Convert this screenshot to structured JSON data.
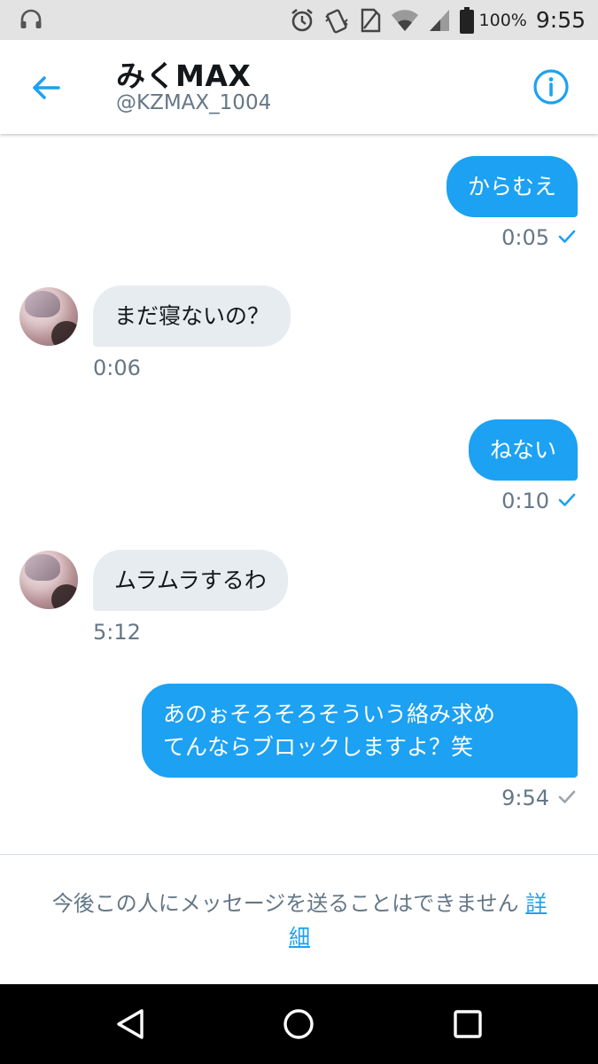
{
  "status_bar": {
    "battery": "100%",
    "time": "9:55",
    "icons": [
      "headphones-icon",
      "alarm-icon",
      "vibrate-icon",
      "no-sim-icon",
      "wifi-icon",
      "signal-icon",
      "battery-icon"
    ]
  },
  "header": {
    "name": "みくMAX",
    "handle": "@KZMAX_1004",
    "back_icon": "back-arrow-icon",
    "info_icon": "info-icon"
  },
  "messages": [
    {
      "direction": "out",
      "text": "からむえ",
      "time": "0:05",
      "read": true
    },
    {
      "direction": "in",
      "text": "まだ寝ないの？",
      "time": "0:06"
    },
    {
      "direction": "out",
      "text": "ねない",
      "time": "0:10",
      "read": true
    },
    {
      "direction": "in",
      "text": "ムラムラするわ",
      "time": "5:12"
    },
    {
      "direction": "out",
      "lines": [
        "あのぉそろそろそういう絡み求め",
        "てんならブロックしますよ？笑"
      ],
      "time": "9:54",
      "read": false
    }
  ],
  "notice": {
    "text": "今後この人にメッセージを送ることはできません",
    "link_part1": "詳",
    "link_part2": "細"
  },
  "nav_bar": {
    "icons": [
      "back-triangle-icon",
      "home-circle-icon",
      "recents-square-icon"
    ]
  },
  "colors": {
    "accent": "#1da1f2",
    "incoming_bubble": "#e6ecf0",
    "meta_text": "#657786",
    "read_check": "#1da1f2",
    "unread_check": "#9aa5ad"
  }
}
